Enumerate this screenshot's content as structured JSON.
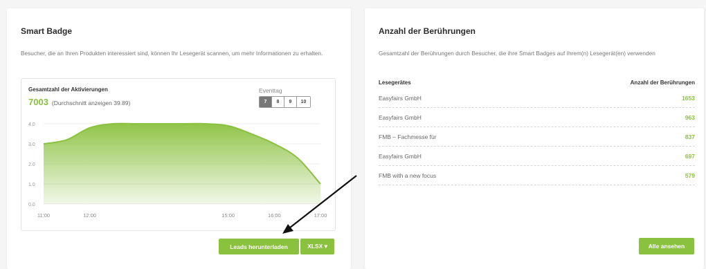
{
  "smart_badge": {
    "title": "Smart Badge",
    "description": "Besucher, die an Ihren Produkten interessiert sind, können Ihr Lesegerät scannen, um mehr Informationen zu erhalten.",
    "panel_heading": "Gesamtzahl der Aktivierungen",
    "total_value": "7003",
    "total_sub": "(Durchschnitt anzeigen 39.89)",
    "event_label": "Eventtag",
    "event_days": [
      "7",
      "8",
      "9",
      "10"
    ],
    "event_active": "7",
    "download_button": "Leads herunterladen",
    "format_button": "XLSX ▾"
  },
  "chart_data": {
    "type": "area",
    "x": [
      "11:00",
      "11:30",
      "12:00",
      "12:30",
      "13:00",
      "13:30",
      "14:00",
      "14:30",
      "15:00",
      "15:30",
      "16:00",
      "16:30",
      "17:00"
    ],
    "values": [
      3.0,
      3.2,
      3.8,
      4.0,
      4.0,
      4.0,
      4.0,
      4.0,
      3.9,
      3.5,
      3.0,
      2.3,
      1.0
    ],
    "x_ticks": [
      "11:00",
      "12:00",
      "15:00",
      "16:00",
      "17:00"
    ],
    "y_ticks": [
      "0.0",
      "1.0",
      "2.0",
      "3.0",
      "4.0"
    ],
    "ylim": [
      0,
      4
    ],
    "grid": true,
    "color": "#8ac13f"
  },
  "touches": {
    "title": "Anzahl der Berührungen",
    "description": "Gesamtzahl der Berührungen durch Besucher, die ihre Smart Badges auf Ihrem(n) Lesegerät(en) verwenden",
    "col_reader": "Lesegerätes",
    "col_count": "Anzahl der Berührungen",
    "rows": [
      {
        "name": "Easyfairs GmbH",
        "value": "1653"
      },
      {
        "name": "Easyfairs GmbH",
        "value": "963"
      },
      {
        "name": "FMB – Fachmesse für",
        "value": "837"
      },
      {
        "name": "Easyfairs GmbH",
        "value": "697"
      },
      {
        "name": "FMB with a new focus",
        "value": "579"
      }
    ],
    "view_all_button": "Alle ansehen"
  },
  "colors": {
    "accent": "#8ac13f",
    "arrow": "#111111"
  }
}
